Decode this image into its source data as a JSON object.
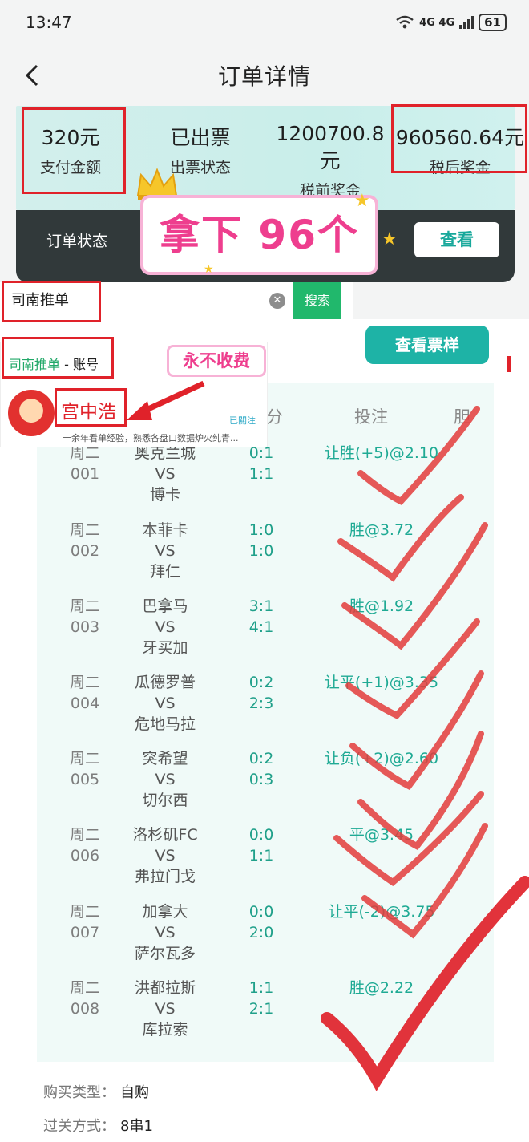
{
  "status_bar": {
    "time": "13:47",
    "signal": "4G 4G",
    "battery": "61"
  },
  "nav": {
    "title": "订单详情"
  },
  "summary": [
    {
      "value": "320元",
      "label": "支付金额"
    },
    {
      "value": "已出票",
      "label": "出票状态"
    },
    {
      "value": "1200700.8元",
      "label": "税前奖金"
    },
    {
      "value": "960560.64元",
      "label": "税后奖金"
    }
  ],
  "order_bar": {
    "label": "订单状态",
    "view_button": "查看"
  },
  "promo": {
    "text": "拿下 96个"
  },
  "search": {
    "value": "司南推单",
    "button": "搜索"
  },
  "ticket_button": "查看票样",
  "account": {
    "name_green": "司南推单",
    "name_suffix": " - 账号",
    "free_tag": "永不收费",
    "user": "宫中浩",
    "followed": "已關注",
    "bio": "十余年看单经验，熟悉各盘口数据炉火纯青..."
  },
  "table": {
    "headers": [
      "分",
      "投注",
      "胆"
    ],
    "rows": [
      {
        "day": "周二",
        "num": "001",
        "home": "奥克兰城",
        "vs": "VS",
        "away": "博卡",
        "half": "0:1",
        "full": "1:1",
        "bet": "让胜(+5)@2.10"
      },
      {
        "day": "周二",
        "num": "002",
        "home": "本菲卡",
        "vs": "VS",
        "away": "拜仁",
        "half": "1:0",
        "full": "1:0",
        "bet": "胜@3.72"
      },
      {
        "day": "周二",
        "num": "003",
        "home": "巴拿马",
        "vs": "VS",
        "away": "牙买加",
        "half": "3:1",
        "full": "4:1",
        "bet": "胜@1.92"
      },
      {
        "day": "周二",
        "num": "004",
        "home": "瓜德罗普",
        "vs": "VS",
        "away": "危地马拉",
        "half": "0:2",
        "full": "2:3",
        "bet": "让平(+1)@3.35"
      },
      {
        "day": "周二",
        "num": "005",
        "home": "突希望",
        "vs": "VS",
        "away": "切尔西",
        "half": "0:2",
        "full": "0:3",
        "bet": "让负(+2)@2.60"
      },
      {
        "day": "周二",
        "num": "006",
        "home": "洛杉矶FC",
        "vs": "VS",
        "away": "弗拉门戈",
        "half": "0:0",
        "full": "1:1",
        "bet": "平@3.45"
      },
      {
        "day": "周二",
        "num": "007",
        "home": "加拿大",
        "vs": "VS",
        "away": "萨尔瓦多",
        "half": "0:0",
        "full": "2:0",
        "bet": "让平(-2)@3.75"
      },
      {
        "day": "周二",
        "num": "008",
        "home": "洪都拉斯",
        "vs": "VS",
        "away": "库拉索",
        "half": "1:1",
        "full": "2:1",
        "bet": "胜@2.22"
      }
    ]
  },
  "info": [
    {
      "label": "购买类型：",
      "value": "自购"
    },
    {
      "label": "过关方式：",
      "value": "8串1"
    }
  ],
  "colors": {
    "accent": "#1eb3a6",
    "highlight_red": "#e0222a",
    "promo_pink": "#ee3e8e"
  }
}
